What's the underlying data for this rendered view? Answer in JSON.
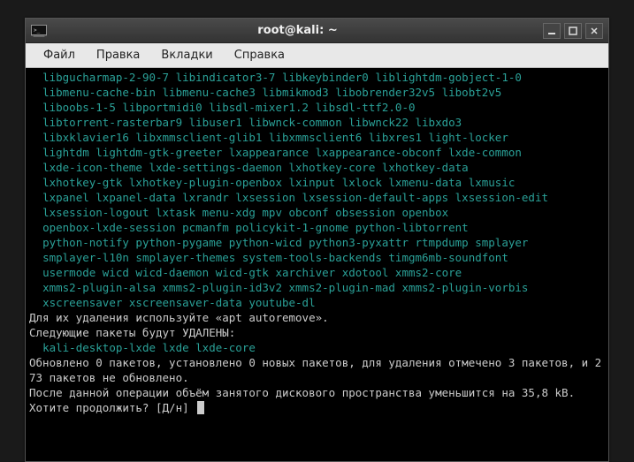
{
  "titlebar": {
    "title": "root@kali: ~"
  },
  "menubar": {
    "items": [
      {
        "label": "Файл"
      },
      {
        "label": "Правка"
      },
      {
        "label": "Вкладки"
      },
      {
        "label": "Справка"
      }
    ]
  },
  "terminal": {
    "pkg_lines": [
      "  libgucharmap-2-90-7 libindicator3-7 libkeybinder0 liblightdm-gobject-1-0",
      "  libmenu-cache-bin libmenu-cache3 libmikmod3 libobrender32v5 libobt2v5",
      "  liboobs-1-5 libportmidi0 libsdl-mixer1.2 libsdl-ttf2.0-0",
      "  libtorrent-rasterbar9 libuser1 libwnck-common libwnck22 libxdo3",
      "  libxklavier16 libxmmsclient-glib1 libxmmsclient6 libxres1 light-locker",
      "  lightdm lightdm-gtk-greeter lxappearance lxappearance-obconf lxde-common",
      "  lxde-icon-theme lxde-settings-daemon lxhotkey-core lxhotkey-data",
      "  lxhotkey-gtk lxhotkey-plugin-openbox lxinput lxlock lxmenu-data lxmusic",
      "  lxpanel lxpanel-data lxrandr lxsession lxsession-default-apps lxsession-edit",
      "  lxsession-logout lxtask menu-xdg mpv obconf obsession openbox",
      "  openbox-lxde-session pcmanfm policykit-1-gnome python-libtorrent",
      "  python-notify python-pygame python-wicd python3-pyxattr rtmpdump smplayer",
      "  smplayer-l10n smplayer-themes system-tools-backends timgm6mb-soundfont",
      "  usermode wicd wicd-daemon wicd-gtk xarchiver xdotool xmms2-core",
      "  xmms2-plugin-alsa xmms2-plugin-id3v2 xmms2-plugin-mad xmms2-plugin-vorbis",
      "  xscreensaver xscreensaver-data youtube-dl"
    ],
    "autoremove_hint": "Для их удаления используйте «apt autoremove».",
    "remove_header": "Следующие пакеты будут УДАЛЕНЫ:",
    "remove_list": "  kali-desktop-lxde lxde lxde-core",
    "summary1": "Обновлено 0 пакетов, установлено 0 новых пакетов, для удаления отмечено 3 пакетов, и 273 пакетов не обновлено.",
    "summary2": "После данной операции объём занятого дискового пространства уменьшится на 35,8 kB.",
    "prompt": "Хотите продолжить? [Д/н] "
  }
}
